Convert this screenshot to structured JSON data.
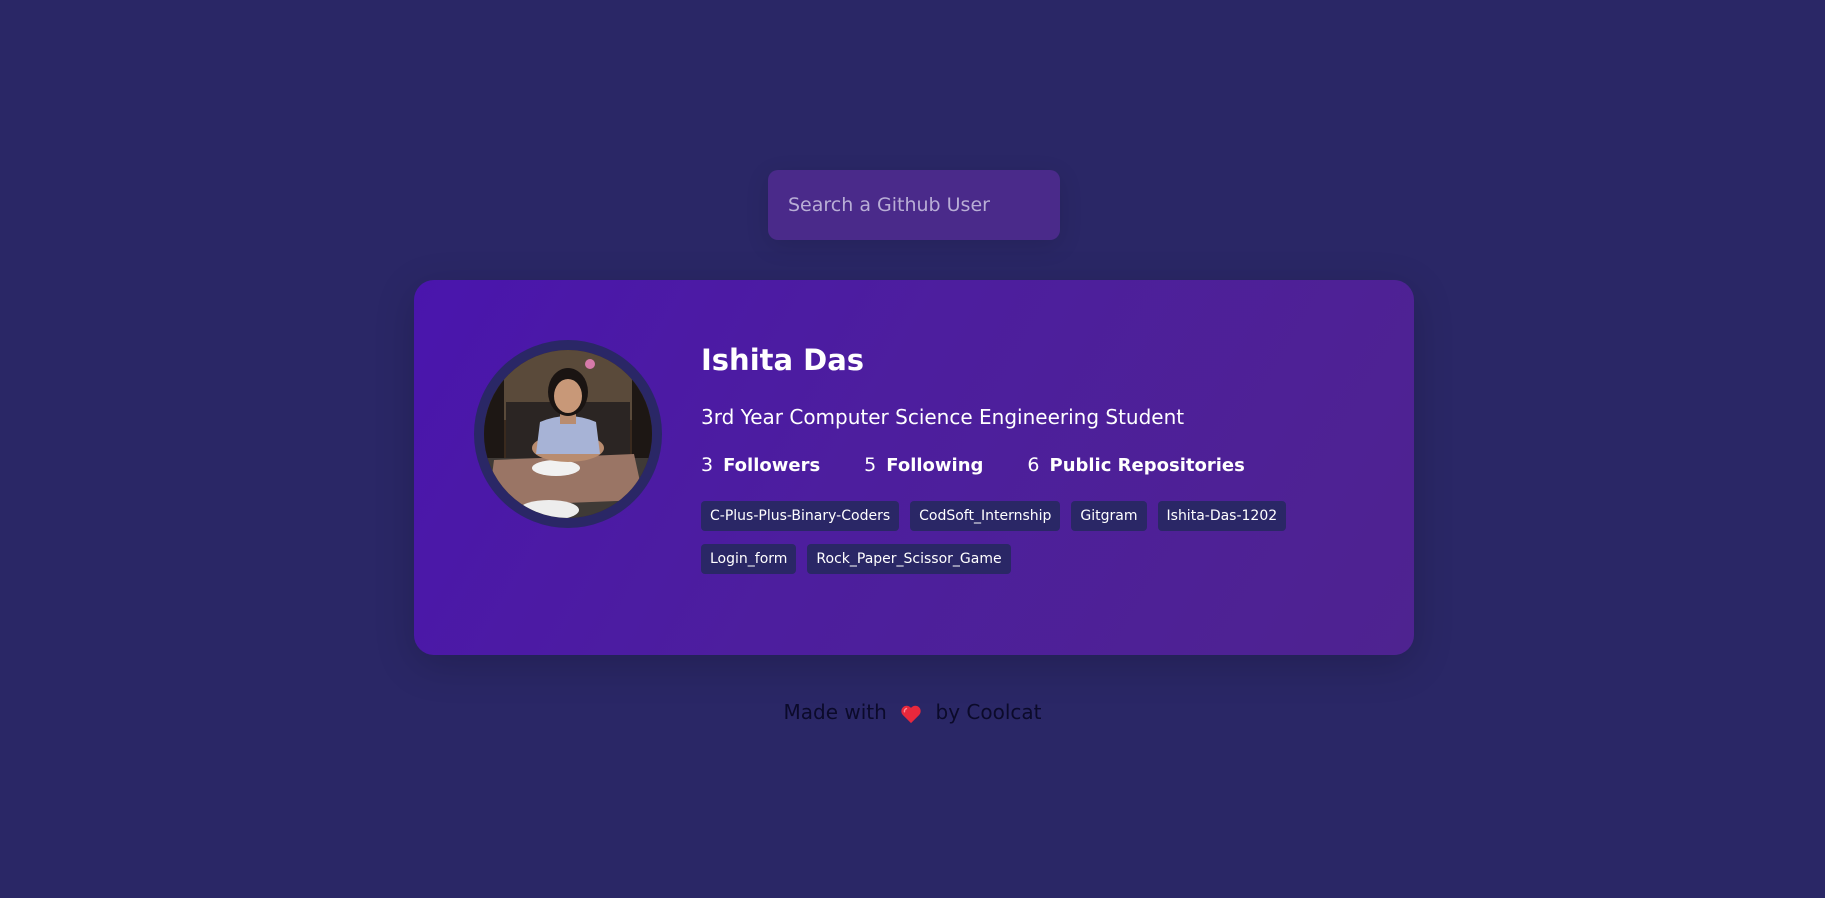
{
  "search": {
    "placeholder": "Search a Github User",
    "value": ""
  },
  "profile": {
    "name": "Ishita Das",
    "bio": "3rd Year Computer Science Engineering Student",
    "stats": [
      {
        "value": "3",
        "label": "Followers"
      },
      {
        "value": "5",
        "label": "Following"
      },
      {
        "value": "6",
        "label": "Public Repositories"
      }
    ],
    "repos": [
      "C-Plus-Plus-Binary-Coders",
      "CodSoft_Internship",
      "Gitgram",
      "Ishita-Das-1202",
      "Login_form",
      "Rock_Paper_Scissor_Game"
    ],
    "avatar_icon": "avatar-photo"
  },
  "footer": {
    "prefix": "Made with",
    "icon": "heart-icon",
    "suffix": "by Coolcat"
  },
  "colors": {
    "background": "#2a2766",
    "card_start": "#4a15ad",
    "card_end": "#4e2390",
    "search_bg": "#4a2a8a",
    "tag_bg": "#2a2766",
    "heart": "#e8283c"
  }
}
